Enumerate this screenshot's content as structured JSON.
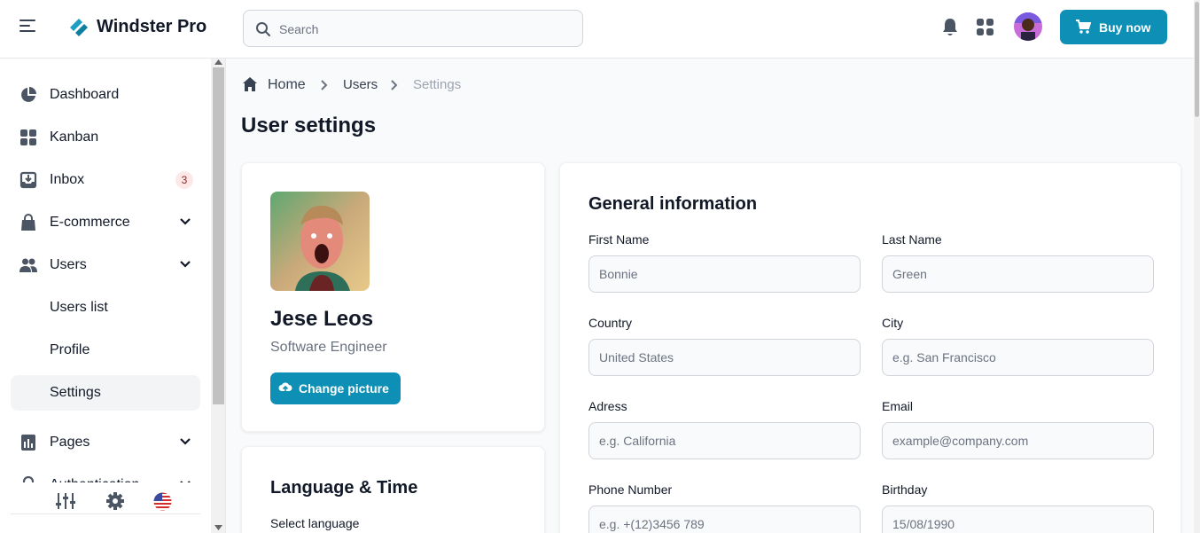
{
  "app": {
    "brand": "Windster Pro"
  },
  "header": {
    "search_placeholder": "Search",
    "buy_label": "Buy now",
    "colors": {
      "accent": "#0e8fb5"
    }
  },
  "sidebar": {
    "items": [
      {
        "label": "Dashboard",
        "icon": "pie-chart-icon"
      },
      {
        "label": "Kanban",
        "icon": "grid-icon"
      },
      {
        "label": "Inbox",
        "icon": "inbox-icon",
        "badge": "3"
      },
      {
        "label": "E-commerce",
        "icon": "shopping-bag-icon"
      },
      {
        "label": "Users",
        "icon": "users-icon"
      },
      {
        "label": "Users list"
      },
      {
        "label": "Profile"
      },
      {
        "label": "Settings",
        "active": true
      },
      {
        "label": "Pages",
        "icon": "chart-icon"
      },
      {
        "label": "Authentication",
        "icon": "lock-icon"
      }
    ]
  },
  "breadcrumb": {
    "home": "Home",
    "users": "Users",
    "current": "Settings"
  },
  "page": {
    "title": "User settings"
  },
  "profile": {
    "name": "Jese Leos",
    "role": "Software Engineer",
    "change_picture": "Change picture"
  },
  "language": {
    "title": "Language & Time",
    "select_label": "Select language"
  },
  "general": {
    "title": "General information",
    "first_name": {
      "label": "First Name",
      "placeholder": "Bonnie"
    },
    "last_name": {
      "label": "Last Name",
      "placeholder": "Green"
    },
    "country": {
      "label": "Country",
      "placeholder": "United States"
    },
    "city": {
      "label": "City",
      "placeholder": "e.g. San Francisco"
    },
    "address": {
      "label": "Adress",
      "placeholder": "e.g. California"
    },
    "email": {
      "label": "Email",
      "placeholder": "example@company.com"
    },
    "phone": {
      "label": "Phone Number",
      "placeholder": "e.g. +(12)3456 789"
    },
    "birthday": {
      "label": "Birthday",
      "placeholder": "15/08/1990"
    }
  }
}
